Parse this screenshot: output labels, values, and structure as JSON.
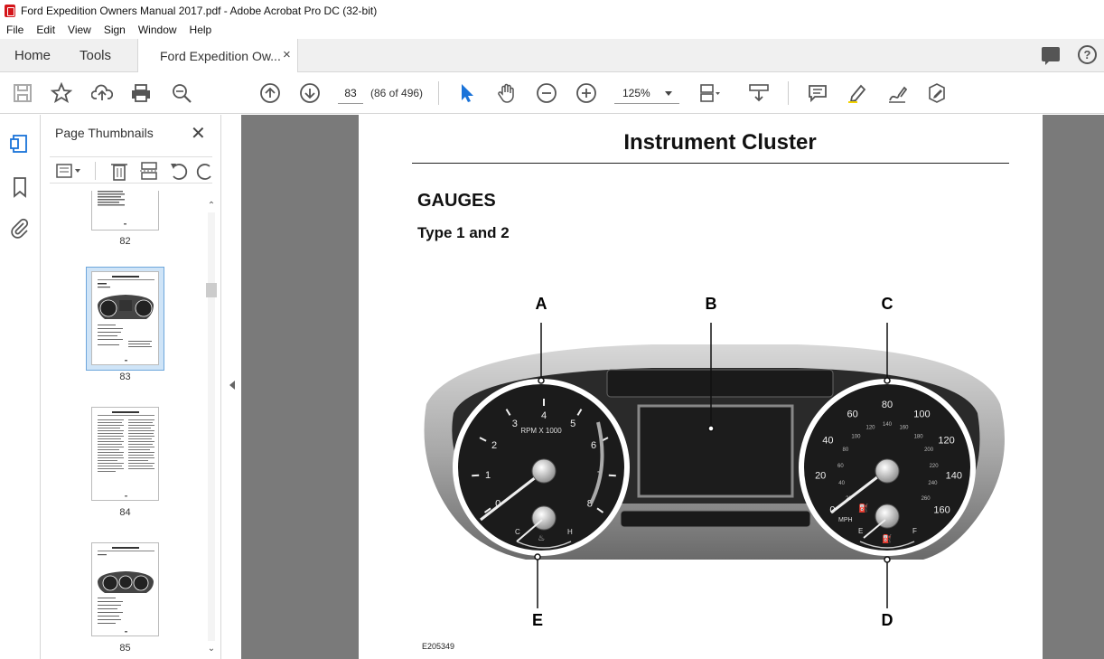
{
  "window": {
    "title": "Ford Expedition Owners Manual 2017.pdf - Adobe Acrobat Pro DC (32-bit)"
  },
  "menu": [
    "File",
    "Edit",
    "View",
    "Sign",
    "Window",
    "Help"
  ],
  "tabs": {
    "home": "Home",
    "tools": "Tools",
    "document": "Ford Expedition Ow...",
    "close_symbol": "×"
  },
  "toolbar": {
    "page_number": "83",
    "page_of": "(86 of 496)",
    "zoom": "125%",
    "icons": [
      "save-icon",
      "star-icon",
      "upload-icon",
      "print-icon",
      "search-icon",
      "prev-page-icon",
      "next-page-icon",
      "select-arrow-icon",
      "hand-icon",
      "zoom-out-icon",
      "zoom-in-icon",
      "fit-page-icon",
      "scroll-mode-icon",
      "comment-icon",
      "highlight-icon",
      "sign-icon",
      "edit-icon"
    ]
  },
  "thumbnail_panel": {
    "title": "Page Thumbnails",
    "close_symbol": "✕",
    "thumbnails": [
      {
        "label": "82",
        "selected": false
      },
      {
        "label": "83",
        "selected": true
      },
      {
        "label": "84",
        "selected": false
      },
      {
        "label": "85",
        "selected": false
      }
    ]
  },
  "page": {
    "title": "Instrument Cluster",
    "section": "GAUGES",
    "subsection": "Type 1 and 2",
    "figure_code": "E205349",
    "callouts": [
      "A",
      "B",
      "C",
      "D",
      "E"
    ],
    "tachometer": {
      "label": "RPM X 1000",
      "ticks": [
        "0",
        "1",
        "2",
        "3",
        "4",
        "5",
        "6",
        "7",
        "8"
      ],
      "temp_low": "C",
      "temp_high": "H"
    },
    "speedometer": {
      "unit": "MPH",
      "mph_ticks": [
        "0",
        "20",
        "40",
        "60",
        "80",
        "100",
        "120",
        "140",
        "160"
      ],
      "kmh_ticks": [
        "20",
        "40",
        "60",
        "80",
        "100",
        "120",
        "140",
        "160",
        "180",
        "200",
        "220",
        "240",
        "260"
      ],
      "fuel_empty": "E",
      "fuel_full": "F"
    }
  }
}
